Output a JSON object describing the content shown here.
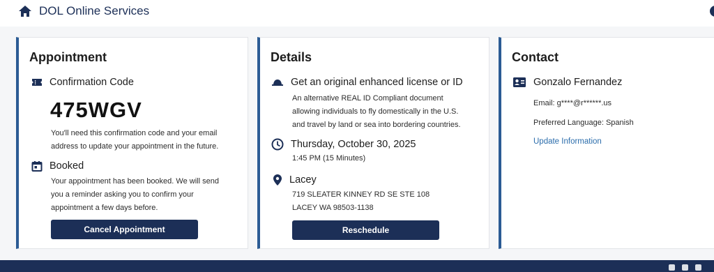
{
  "header": {
    "title": "DOL Online Services",
    "home_icon": "home-icon"
  },
  "appointment": {
    "title": "Appointment",
    "confirmation_label": "Confirmation Code",
    "confirmation_code": "475WGV",
    "code_note_line1": "You'll need this confirmation code and your email",
    "code_note_line2": "address to update your appointment in the future.",
    "status_label": "Booked",
    "status_note_line1": "Your appointment has been booked. We will send",
    "status_note_line2": "you a reminder asking you to confirm your",
    "status_note_line3": "appointment a few days before.",
    "cancel_label": "Cancel Appointment"
  },
  "details": {
    "title": "Details",
    "service_label": "Get an original enhanced license or ID",
    "service_desc_line1": "An alternative REAL ID Compliant document",
    "service_desc_line2": "allowing individuals to fly domestically in the U.S.",
    "service_desc_line3": "and travel by land or sea into bordering countries.",
    "date_label": "Thursday, October 30, 2025",
    "time_label": "1:45 PM (15 Minutes)",
    "location_label": "Lacey",
    "address_line1": "719 SLEATER KINNEY RD SE STE 108",
    "address_line2": "LACEY WA 98503-1138",
    "reschedule_label": "Reschedule"
  },
  "contact": {
    "title": "Contact",
    "name": "Gonzalo Fernandez",
    "email_line": "Email: g****@r******.us",
    "language_line": "Preferred Language: Spanish",
    "update_link": "Update Information"
  },
  "colors": {
    "navy": "#1c2f57",
    "accent_border": "#2b5b94",
    "link": "#2a6cab"
  }
}
